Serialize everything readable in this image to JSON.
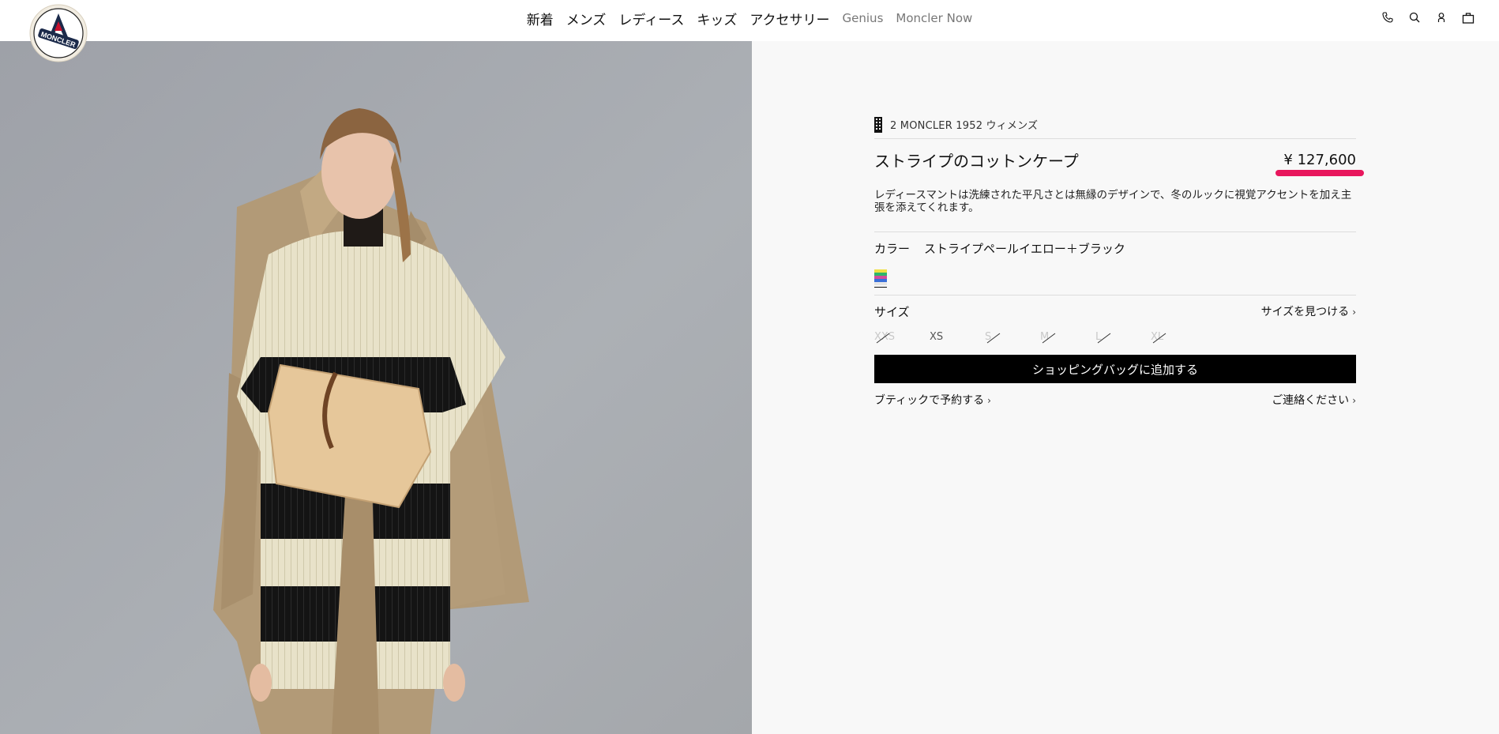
{
  "nav": {
    "items": [
      "新着",
      "メンズ",
      "レディース",
      "キッズ",
      "アクセサリー",
      "Genius",
      "Moncler Now"
    ]
  },
  "logo": {
    "text": "MONCLER"
  },
  "product": {
    "brand": "2 MONCLER 1952 ウィメンズ",
    "title": "ストライプのコットンケープ",
    "price": "¥ 127,600",
    "description": "レディースマントは洗練された平凡さとは無縁のデザインで、冬のルックに視覚アクセントを加え主張を添えてくれます。",
    "color_label": "カラー",
    "color_value": "ストライプペールイエロー＋ブラック",
    "size_label": "サイズ",
    "size_finder": "サイズを見つける",
    "sizes": [
      {
        "label": "XXS",
        "available": false
      },
      {
        "label": "XS",
        "available": true
      },
      {
        "label": "S",
        "available": false
      },
      {
        "label": "M",
        "available": false
      },
      {
        "label": "L",
        "available": false
      },
      {
        "label": "XL",
        "available": false
      }
    ],
    "add_to_bag": "ショッピングバッグに追加する",
    "boutique": "ブティックで予約する",
    "contact": "ご連絡ください"
  },
  "colors": {
    "price_highlight": "#e8175d",
    "cta_bg": "#000000"
  },
  "icons": [
    "phone-icon",
    "search-icon",
    "account-icon",
    "bag-icon"
  ]
}
